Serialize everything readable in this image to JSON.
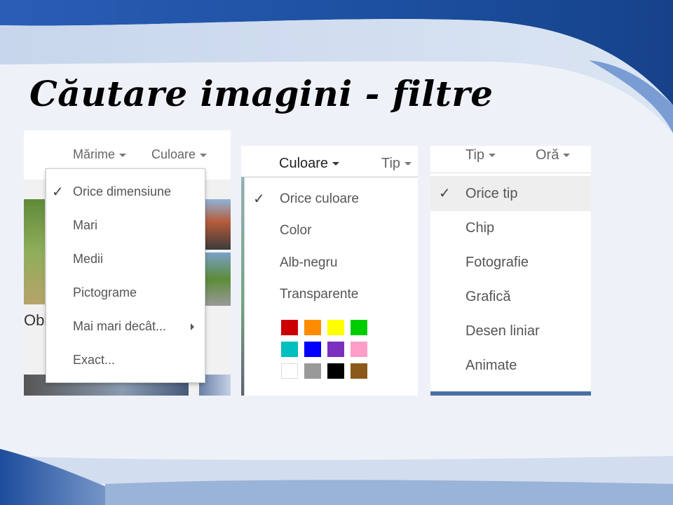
{
  "slide": {
    "title": "Căutare imagini - filtre"
  },
  "shot1": {
    "header": {
      "size_label": "Mărime",
      "color_label": "Culoare"
    },
    "menu": {
      "items": [
        {
          "label": "Orice dimensiune",
          "checked": true
        },
        {
          "label": "Mari"
        },
        {
          "label": "Medii"
        },
        {
          "label": "Pictograme"
        },
        {
          "label": "Mai mari decât...",
          "has_submenu": true
        },
        {
          "label": "Exact..."
        }
      ]
    },
    "partial_text": "Obi"
  },
  "shot2": {
    "header": {
      "color_label": "Culoare",
      "type_label": "Tip"
    },
    "menu": {
      "items": [
        {
          "label": "Orice culoare",
          "checked": true
        },
        {
          "label": "Color"
        },
        {
          "label": "Alb-negru"
        },
        {
          "label": "Transparente"
        }
      ],
      "swatches": [
        "#cc0000",
        "#ff8c00",
        "#ffff00",
        "#00cc00",
        "#00bfbf",
        "#0000ff",
        "#7b2fbe",
        "#ff9ec8",
        "#ffffff",
        "#999999",
        "#000000",
        "#8b5a1a"
      ]
    }
  },
  "shot3": {
    "header": {
      "type_label": "Tip",
      "time_label": "Oră"
    },
    "menu": {
      "items": [
        {
          "label": "Orice tip",
          "checked": true
        },
        {
          "label": "Chip"
        },
        {
          "label": "Fotografie"
        },
        {
          "label": "Grafică"
        },
        {
          "label": "Desen liniar"
        },
        {
          "label": "Animate"
        }
      ]
    }
  },
  "colors": {
    "slide_blue": "#1f4fa0",
    "slide_light": "#eef2f8"
  }
}
